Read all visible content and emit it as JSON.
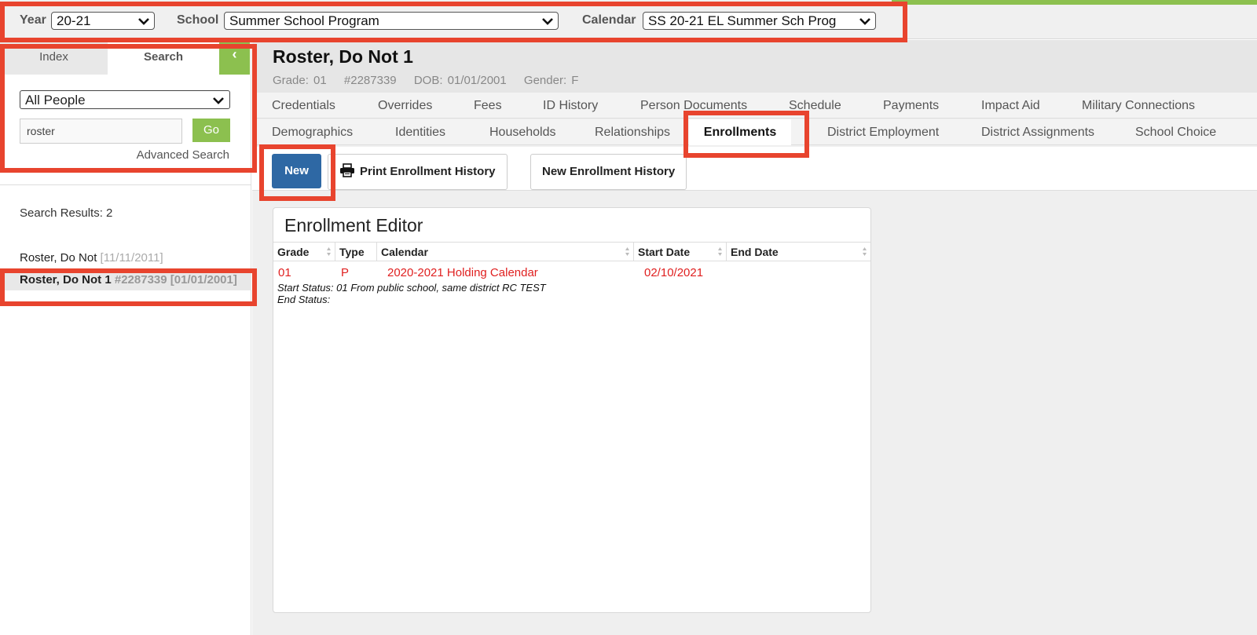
{
  "top_bar": {
    "year_label": "Year",
    "year_value": "20-21",
    "school_label": "School",
    "school_value": "Summer School Program",
    "calendar_label": "Calendar",
    "calendar_value": "SS 20-21 EL Summer Sch Prog",
    "accent_color": "#8cc04f"
  },
  "left_panel": {
    "tabs": {
      "index": "Index",
      "search": "Search"
    },
    "collapse_glyph": "‹",
    "people_filter": "All People",
    "search_value": "roster",
    "go_label": "Go",
    "advanced_search": "Advanced Search",
    "results_count": "Search Results: 2",
    "results": [
      {
        "name": "Roster, Do Not",
        "meta": "[11/11/2011]",
        "selected": false
      },
      {
        "name": "Roster, Do Not 1",
        "id": "#2287339",
        "meta": "[01/01/2001]",
        "selected": true
      }
    ]
  },
  "person": {
    "name": "Roster, Do Not 1",
    "grade": "Grade: 01",
    "id": "#2287339",
    "dob": "DOB: 01/01/2001",
    "gender": "Gender: F"
  },
  "tabs_row1": [
    "Credentials",
    "Overrides",
    "Fees",
    "ID History",
    "Person Documents",
    "Schedule",
    "Payments",
    "Impact Aid",
    "Military Connections"
  ],
  "tabs_row2": [
    "Demographics",
    "Identities",
    "Households",
    "Relationships",
    "Enrollments",
    "District Employment",
    "District Assignments",
    "School Choice"
  ],
  "active_tab": "Enrollments",
  "toolbar": {
    "new_label": "New",
    "print_label": "Print Enrollment History",
    "new_history_label": "New Enrollment History",
    "new_button_color": "#2e68a4"
  },
  "editor": {
    "title": "Enrollment Editor",
    "columns": [
      "Grade",
      "Type",
      "Calendar",
      "Start Date",
      "End Date"
    ],
    "row": {
      "grade": "01",
      "type": "P",
      "calendar": "2020-2021 Holding Calendar",
      "start_date": "02/10/2021",
      "end_date": "",
      "start_status": "Start Status: 01 From public school, same district RC TEST",
      "end_status": "End Status:"
    },
    "row_text_color": "#e02020"
  },
  "highlight_color": "#e8442e"
}
